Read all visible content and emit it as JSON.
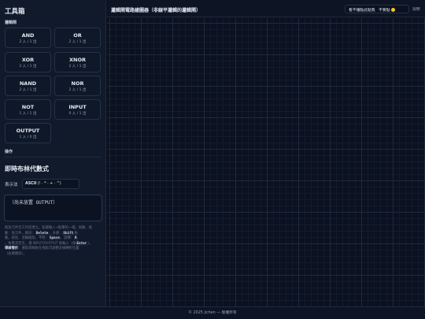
{
  "sidebar": {
    "title": "工具箱",
    "gates_section": "邏輯閘",
    "gates": [
      {
        "name": "AND",
        "desc": "2 入 / 1 出"
      },
      {
        "name": "OR",
        "desc": "2 入 / 1 出"
      },
      {
        "name": "XOR",
        "desc": "2 入 / 1 出"
      },
      {
        "name": "XNOR",
        "desc": "2 入 / 1 出"
      },
      {
        "name": "NAND",
        "desc": "2 入 / 1 出"
      },
      {
        "name": "NOR",
        "desc": "2 入 / 1 出"
      },
      {
        "name": "NOT",
        "desc": "1 入 / 1 出"
      },
      {
        "name": "INPUT",
        "desc": "0 入 / 1 出"
      },
      {
        "name": "OUTPUT",
        "desc": "1 入 / 0 出"
      }
    ],
    "ops_section": "操作",
    "expr_title": "即時布林代數式",
    "rep_label": "表示法",
    "rep_value_bold": "ASCII",
    "rep_value_rest": "(! · * · + · ^)",
    "expr_text": "（尚未放置 OUTPUT）",
    "help": {
      "l1a": "拖放元件至工作區建立。點選輸入→點擊的一端。拖動、拖",
      "l2a": "動：拖元件，刪除：",
      "k_delete": "Delete",
      "l2b": "，多選：",
      "k_shift": "Shift",
      "l2c": "拖",
      "l3a": "動。按住、滾輪縮放，平移：",
      "k_space": "Space",
      "l3b": "，旋轉：",
      "k_r": "R",
      "l4a": "。依需求定名，選 INPUT/OUTPUT 後輸入（按",
      "k_enter": "Enter",
      "l4b": "）。",
      "l5a_hl": "導線彎折",
      "l5b": "：選取導線後在拖點可調整走線轉折位置",
      "l6a": "（右鍵刪除）。"
    }
  },
  "topbar": {
    "title": "邏輯閘電路繪圖器（非線平邏輯的邏輯閘）",
    "dont_understand": "看不懂點此點我",
    "dont_touch": "不要點",
    "link": "說明"
  },
  "footer": {
    "text": "© 2025 jichen — 版權所有"
  }
}
